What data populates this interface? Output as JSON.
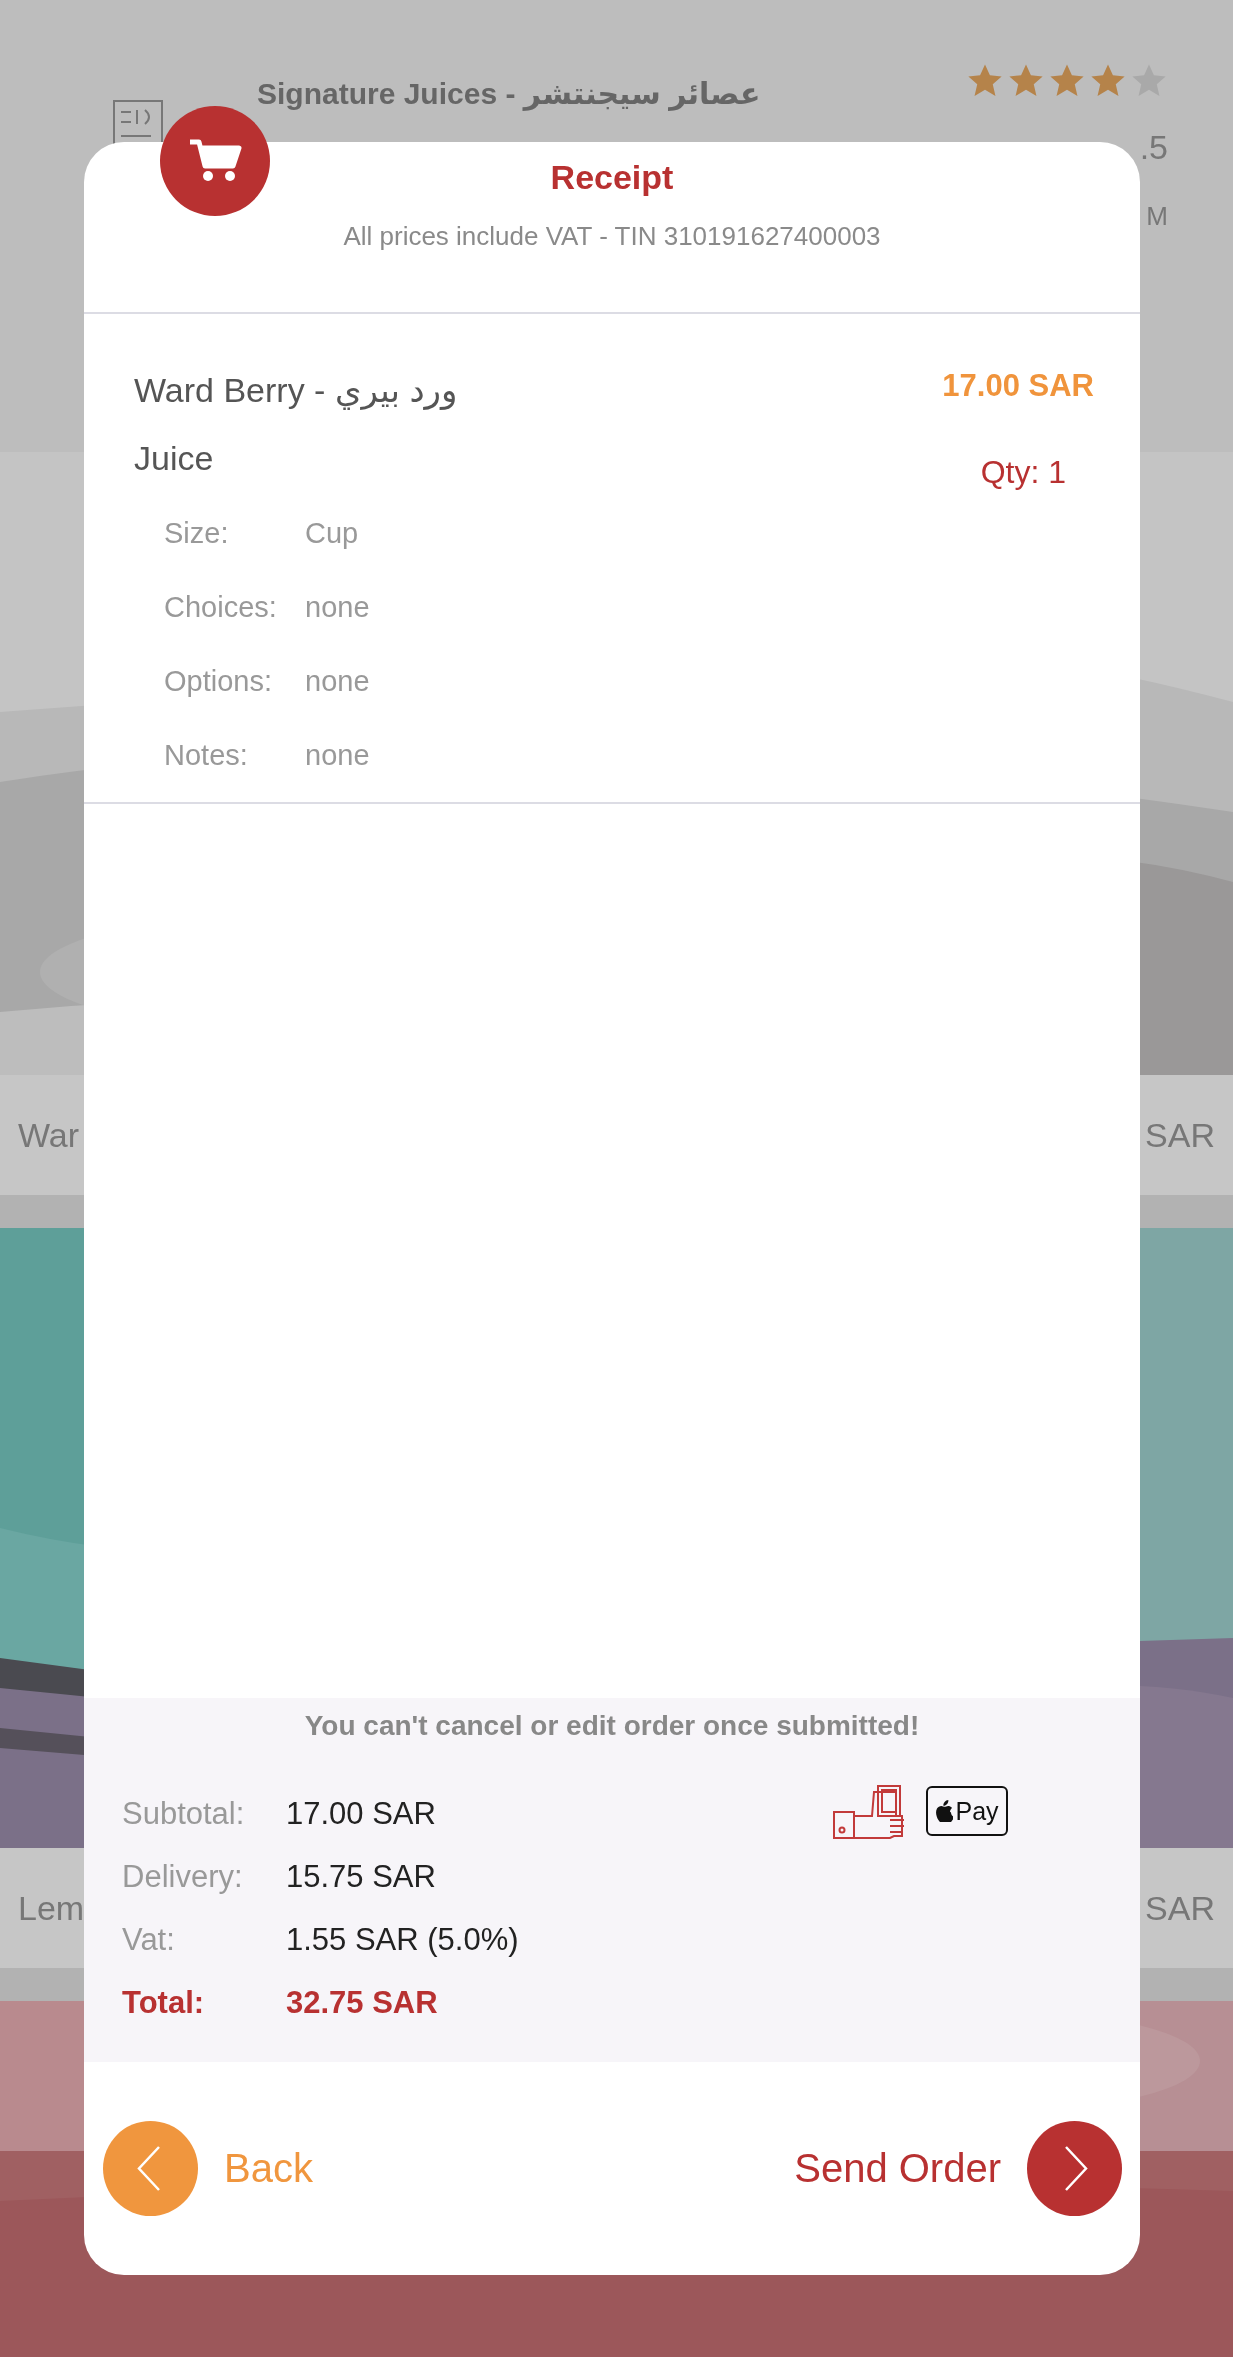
{
  "background": {
    "restaurant_title": "Signature Juices - عصائر سيجنتشر",
    "stars": 4,
    "header_fragments": [
      ".5",
      "M"
    ],
    "rows": [
      {
        "left": "War",
        "right": "SAR"
      },
      {
        "left": "Lem",
        "right": "SAR"
      }
    ]
  },
  "receipt": {
    "title": "Receipt",
    "subtitle": "All prices include VAT - TIN 310191627400003",
    "items": [
      {
        "name_lines": [
          "Ward Berry - ورد بيري",
          "Juice"
        ],
        "price": "17.00 SAR",
        "qty": "Qty: 1",
        "details": [
          {
            "label": "Size:",
            "value": "Cup"
          },
          {
            "label": "Choices:",
            "value": "none"
          },
          {
            "label": "Options:",
            "value": "none"
          },
          {
            "label": "Notes:",
            "value": "none"
          }
        ]
      }
    ],
    "notice": "You can't cancel or edit order once submitted!",
    "summary": [
      {
        "kind": "normal",
        "label": "Subtotal:",
        "value": "17.00 SAR"
      },
      {
        "kind": "normal",
        "label": "Delivery:",
        "value": "15.75 SAR"
      },
      {
        "kind": "normal",
        "label": "Vat:",
        "value": "1.55 SAR (5.0%)"
      },
      {
        "kind": "total",
        "label": "Total:",
        "value": "32.75 SAR"
      }
    ],
    "payment_methods": [
      {
        "kind": "cash"
      },
      {
        "kind": "apple_pay",
        "label": "Pay"
      }
    ],
    "back_button": "Back",
    "send_button": "Send Order"
  }
}
